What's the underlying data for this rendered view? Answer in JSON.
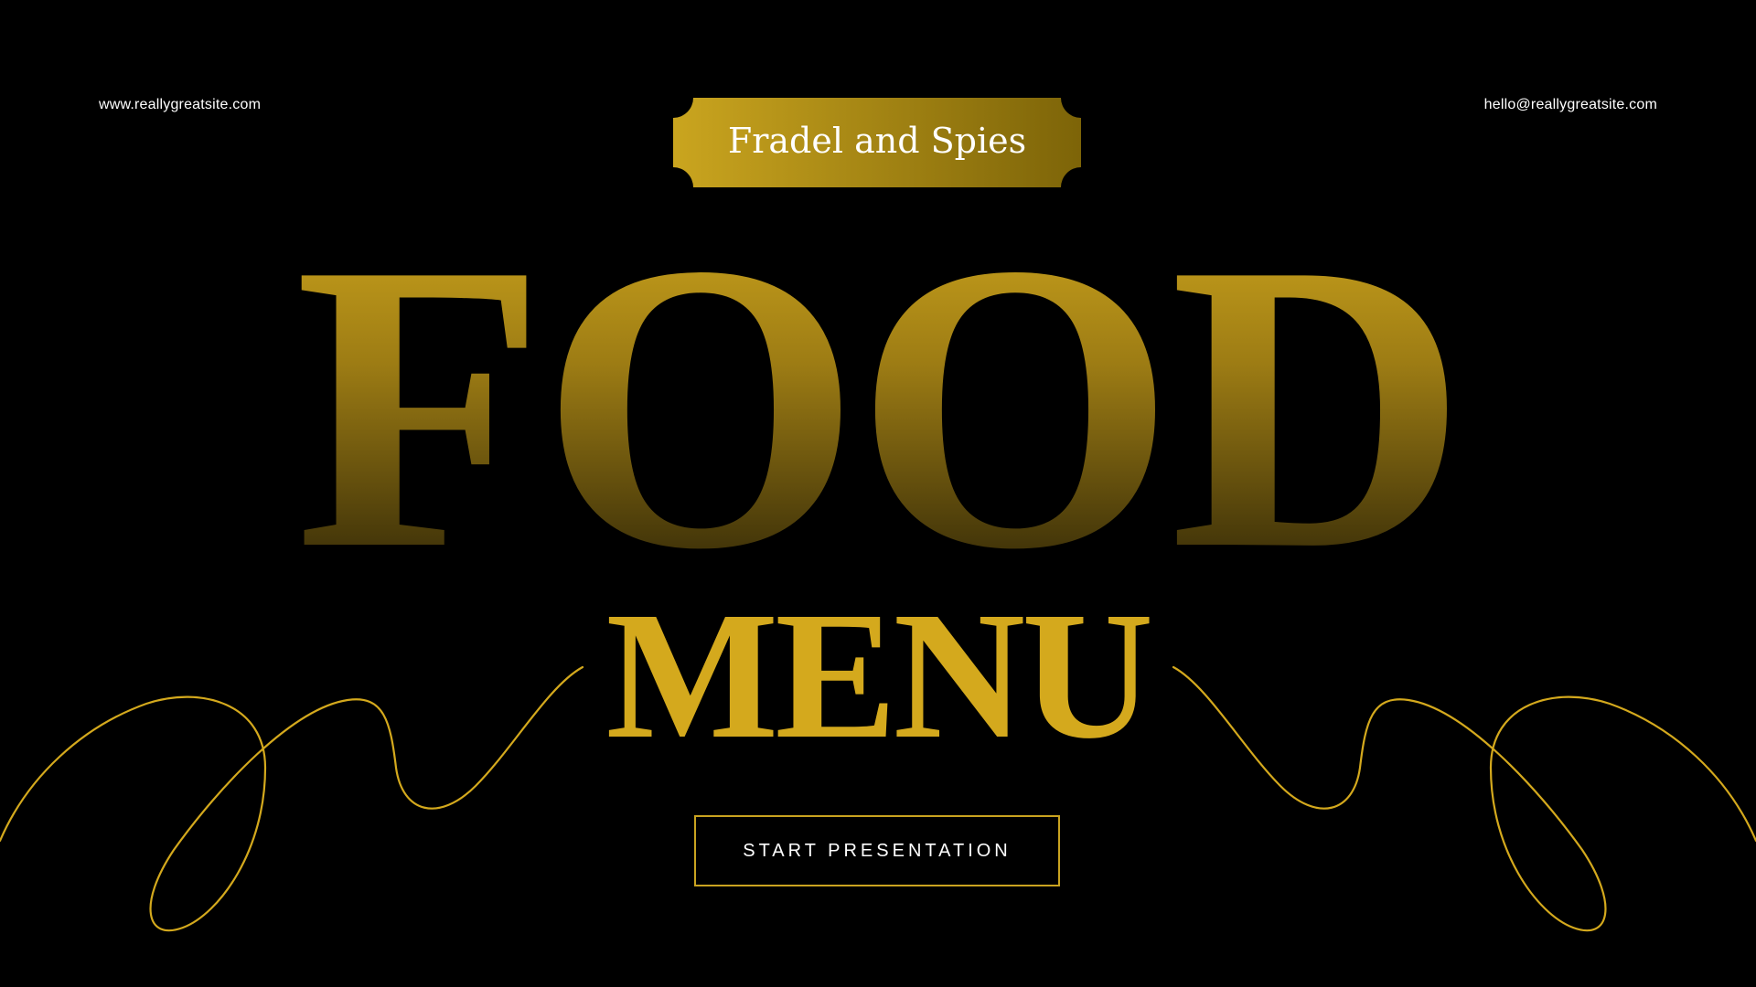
{
  "header": {
    "website": "www.reallygreatsite.com",
    "email": "hello@reallygreatsite.com"
  },
  "badge": {
    "label": "Fradel and Spies"
  },
  "title": {
    "line1": "FOOD",
    "line2": "MENU"
  },
  "start_button": {
    "label": "START PRESENTATION"
  },
  "colors": {
    "background": "#000000",
    "gold": "#d4a91d",
    "badge_gold_light": "#caa51f",
    "badge_gold_dark": "#7d6408",
    "text_white": "#ffffff"
  }
}
